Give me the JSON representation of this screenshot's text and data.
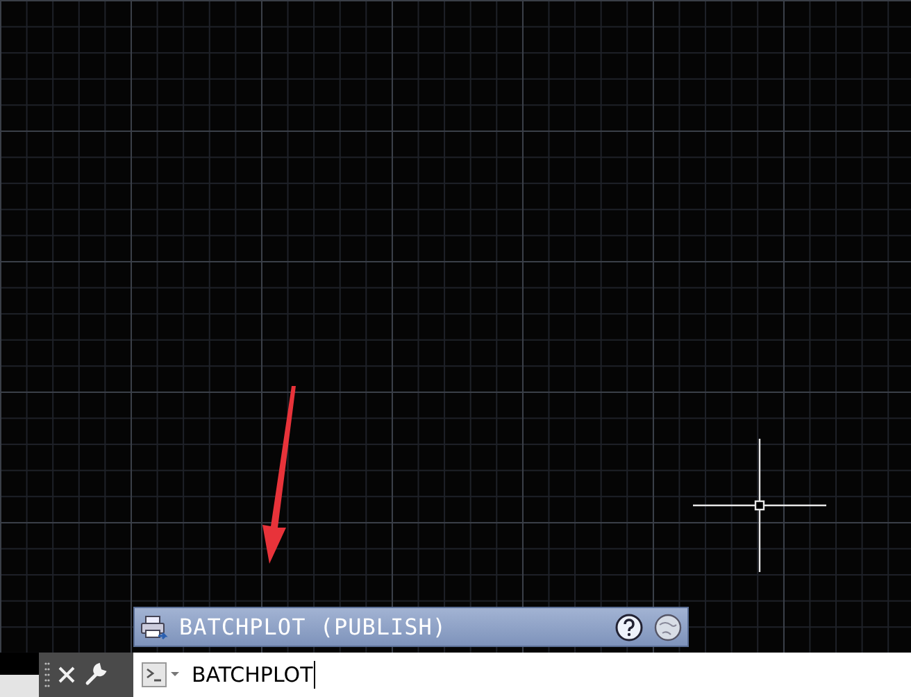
{
  "autocomplete": {
    "entry": "BATCHPLOT (PUBLISH)"
  },
  "command_line": {
    "value": "BATCHPLOT"
  }
}
